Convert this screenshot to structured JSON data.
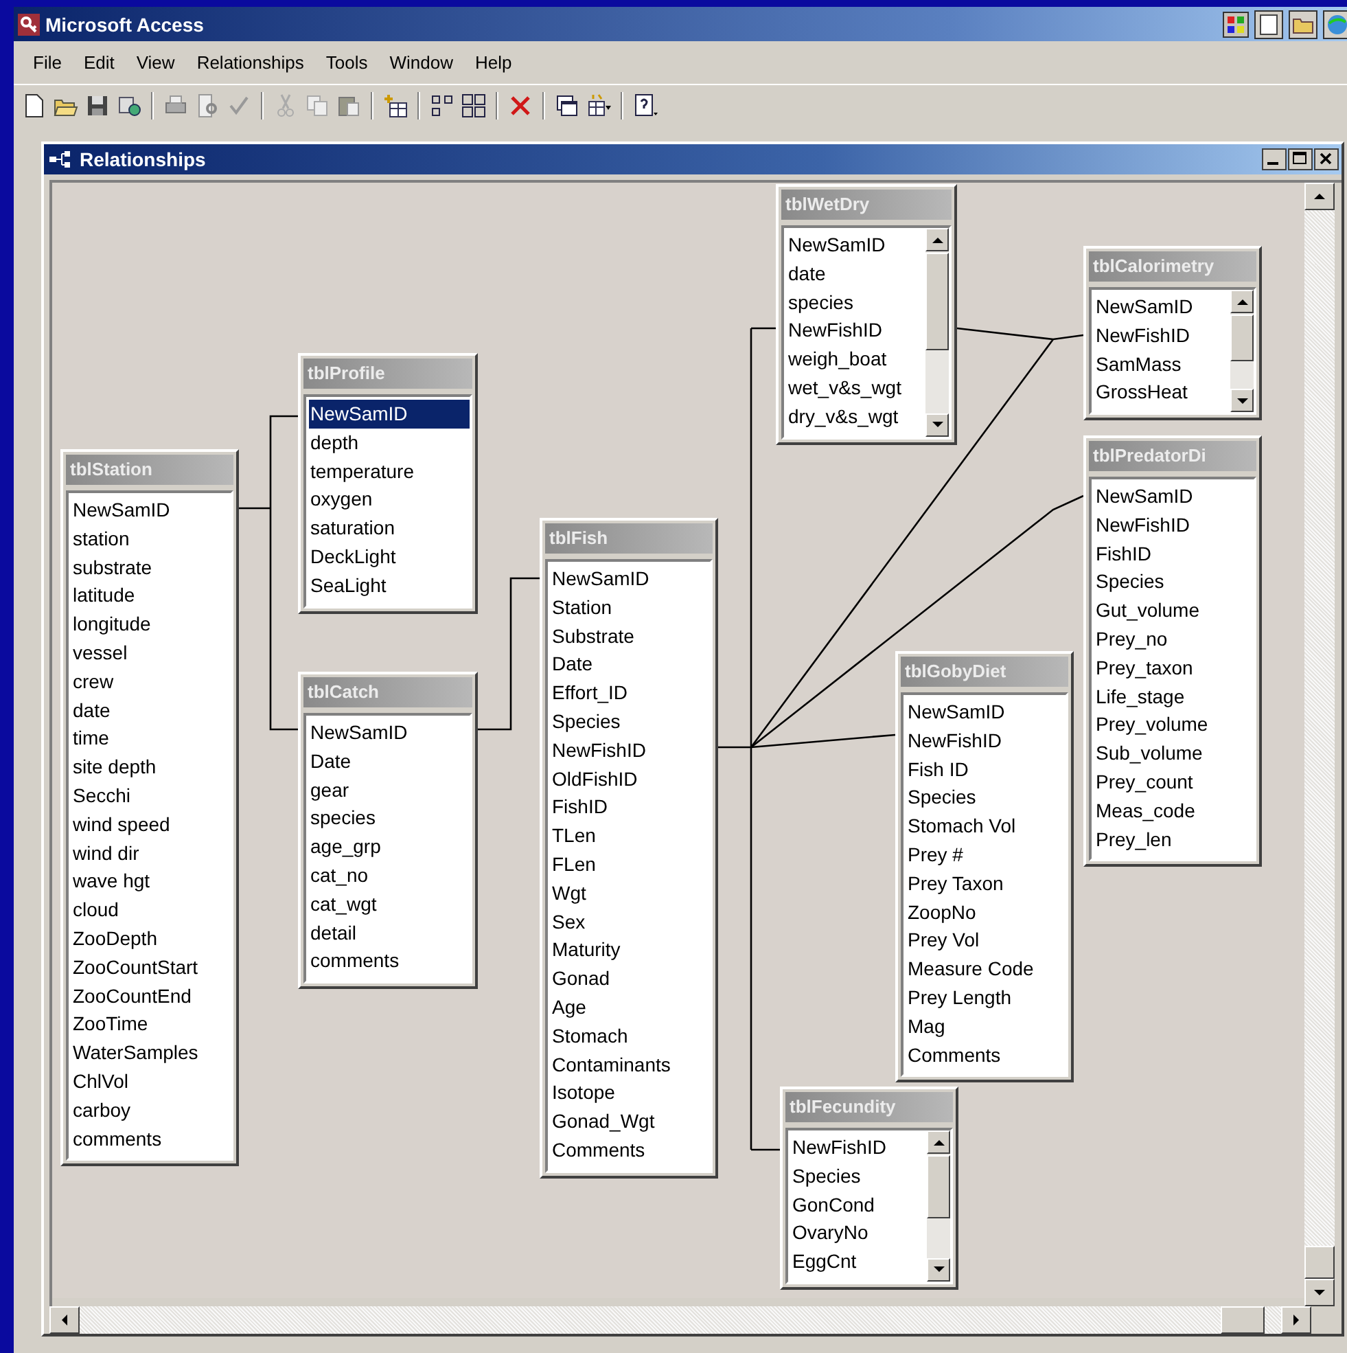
{
  "app": {
    "title": "Microsoft Access"
  },
  "menu": [
    {
      "label": "File"
    },
    {
      "label": "Edit"
    },
    {
      "label": "View"
    },
    {
      "label": "Relationships"
    },
    {
      "label": "Tools"
    },
    {
      "label": "Window"
    },
    {
      "label": "Help"
    }
  ],
  "child_window": {
    "title": "Relationships"
  },
  "tables": [
    {
      "title": "tblStation",
      "scrollable": false,
      "fields": [
        {
          "name": "NewSamID",
          "selected": false
        },
        {
          "name": "station",
          "selected": false
        },
        {
          "name": "substrate",
          "selected": false
        },
        {
          "name": "latitude",
          "selected": false
        },
        {
          "name": "longitude",
          "selected": false
        },
        {
          "name": "vessel",
          "selected": false
        },
        {
          "name": "crew",
          "selected": false
        },
        {
          "name": "date",
          "selected": false
        },
        {
          "name": "time",
          "selected": false
        },
        {
          "name": "site depth",
          "selected": false
        },
        {
          "name": "Secchi",
          "selected": false
        },
        {
          "name": "wind speed",
          "selected": false
        },
        {
          "name": "wind dir",
          "selected": false
        },
        {
          "name": "wave hgt",
          "selected": false
        },
        {
          "name": "cloud",
          "selected": false
        },
        {
          "name": "ZooDepth",
          "selected": false
        },
        {
          "name": "ZooCountStart",
          "selected": false
        },
        {
          "name": "ZooCountEnd",
          "selected": false
        },
        {
          "name": "ZooTime",
          "selected": false
        },
        {
          "name": "WaterSamples",
          "selected": false
        },
        {
          "name": "ChlVol",
          "selected": false
        },
        {
          "name": "carboy",
          "selected": false
        },
        {
          "name": "comments",
          "selected": false
        }
      ]
    },
    {
      "title": "tblProfile",
      "scrollable": false,
      "fields": [
        {
          "name": "NewSamID",
          "selected": true
        },
        {
          "name": "depth",
          "selected": false
        },
        {
          "name": "temperature",
          "selected": false
        },
        {
          "name": "oxygen",
          "selected": false
        },
        {
          "name": "saturation",
          "selected": false
        },
        {
          "name": "DeckLight",
          "selected": false
        },
        {
          "name": "SeaLight",
          "selected": false
        }
      ]
    },
    {
      "title": "tblCatch",
      "scrollable": false,
      "fields": [
        {
          "name": "NewSamID",
          "selected": false
        },
        {
          "name": "Date",
          "selected": false
        },
        {
          "name": "gear",
          "selected": false
        },
        {
          "name": "species",
          "selected": false
        },
        {
          "name": "age_grp",
          "selected": false
        },
        {
          "name": "cat_no",
          "selected": false
        },
        {
          "name": "cat_wgt",
          "selected": false
        },
        {
          "name": "detail",
          "selected": false
        },
        {
          "name": "comments",
          "selected": false
        }
      ]
    },
    {
      "title": "tblFish",
      "scrollable": false,
      "fields": [
        {
          "name": "NewSamID",
          "selected": false
        },
        {
          "name": "Station",
          "selected": false
        },
        {
          "name": "Substrate",
          "selected": false
        },
        {
          "name": "Date",
          "selected": false
        },
        {
          "name": "Effort_ID",
          "selected": false
        },
        {
          "name": "Species",
          "selected": false
        },
        {
          "name": "NewFishID",
          "selected": false
        },
        {
          "name": "OldFishID",
          "selected": false
        },
        {
          "name": "FishID",
          "selected": false
        },
        {
          "name": "TLen",
          "selected": false
        },
        {
          "name": "FLen",
          "selected": false
        },
        {
          "name": "Wgt",
          "selected": false
        },
        {
          "name": "Sex",
          "selected": false
        },
        {
          "name": "Maturity",
          "selected": false
        },
        {
          "name": "Gonad",
          "selected": false
        },
        {
          "name": "Age",
          "selected": false
        },
        {
          "name": "Stomach",
          "selected": false
        },
        {
          "name": "Contaminants",
          "selected": false
        },
        {
          "name": "Isotope",
          "selected": false
        },
        {
          "name": "Gonad_Wgt",
          "selected": false
        },
        {
          "name": "Comments",
          "selected": false
        }
      ]
    },
    {
      "title": "tblWetDry",
      "scrollable": true,
      "fields": [
        {
          "name": "NewSamID",
          "selected": false
        },
        {
          "name": "date",
          "selected": false
        },
        {
          "name": "species",
          "selected": false
        },
        {
          "name": "NewFishID",
          "selected": false
        },
        {
          "name": "weigh_boat",
          "selected": false
        },
        {
          "name": "wet_v&s_wgt",
          "selected": false
        },
        {
          "name": "dry_v&s_wgt",
          "selected": false
        }
      ]
    },
    {
      "title": "tblCalorimetry",
      "scrollable": true,
      "fields": [
        {
          "name": "NewSamID",
          "selected": false
        },
        {
          "name": "NewFishID",
          "selected": false
        },
        {
          "name": "SamMass",
          "selected": false
        },
        {
          "name": "GrossHeat",
          "selected": false
        }
      ]
    },
    {
      "title": "tblPredatorDi",
      "scrollable": false,
      "fields": [
        {
          "name": "NewSamID",
          "selected": false
        },
        {
          "name": "NewFishID",
          "selected": false
        },
        {
          "name": "FishID",
          "selected": false
        },
        {
          "name": "Species",
          "selected": false
        },
        {
          "name": "Gut_volume",
          "selected": false
        },
        {
          "name": "Prey_no",
          "selected": false
        },
        {
          "name": "Prey_taxon",
          "selected": false
        },
        {
          "name": "Life_stage",
          "selected": false
        },
        {
          "name": "Prey_volume",
          "selected": false
        },
        {
          "name": "Sub_volume",
          "selected": false
        },
        {
          "name": "Prey_count",
          "selected": false
        },
        {
          "name": "Meas_code",
          "selected": false
        },
        {
          "name": "Prey_len",
          "selected": false
        }
      ]
    },
    {
      "title": "tblGobyDiet",
      "scrollable": false,
      "fields": [
        {
          "name": "NewSamID",
          "selected": false
        },
        {
          "name": "NewFishID",
          "selected": false
        },
        {
          "name": "Fish ID",
          "selected": false
        },
        {
          "name": "Species",
          "selected": false
        },
        {
          "name": "Stomach Vol",
          "selected": false
        },
        {
          "name": "Prey #",
          "selected": false
        },
        {
          "name": "Prey Taxon",
          "selected": false
        },
        {
          "name": "ZoopNo",
          "selected": false
        },
        {
          "name": "Prey Vol",
          "selected": false
        },
        {
          "name": "Measure Code",
          "selected": false
        },
        {
          "name": "Prey Length",
          "selected": false
        },
        {
          "name": "Mag",
          "selected": false
        },
        {
          "name": "Comments",
          "selected": false
        }
      ]
    },
    {
      "title": "tblFecundity",
      "scrollable": true,
      "fields": [
        {
          "name": "NewFishID",
          "selected": false
        },
        {
          "name": "Species",
          "selected": false
        },
        {
          "name": "GonCond",
          "selected": false
        },
        {
          "name": "OvaryNo",
          "selected": false
        },
        {
          "name": "EggCnt",
          "selected": false
        }
      ]
    }
  ]
}
